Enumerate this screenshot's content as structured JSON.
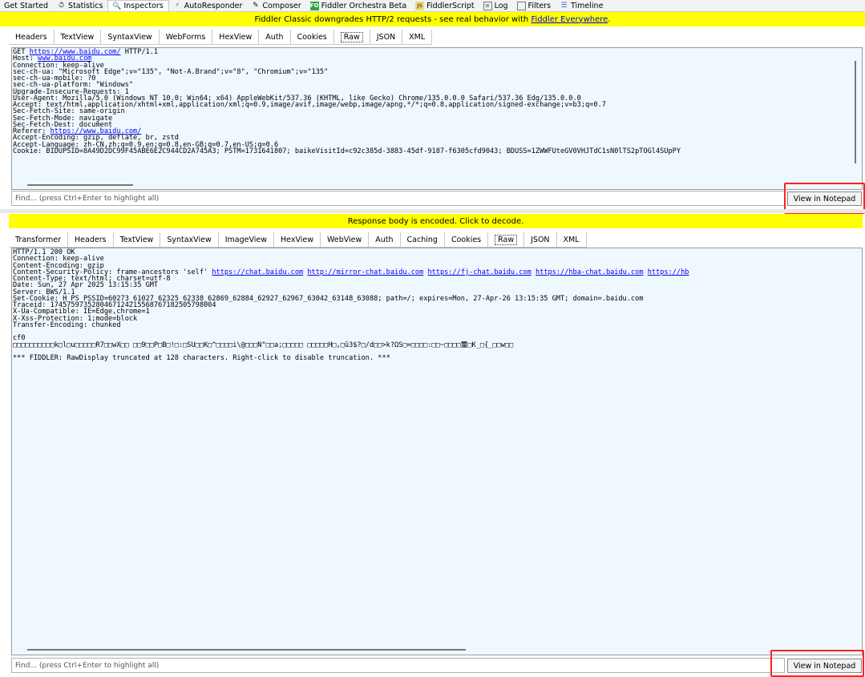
{
  "top_tabs": [
    {
      "label": "Get Started",
      "icon": "none"
    },
    {
      "label": "Statistics",
      "icon": "stopwatch-icon"
    },
    {
      "label": "Inspectors",
      "icon": "inspectors-icon"
    },
    {
      "label": "AutoResponder",
      "icon": "lightning-icon"
    },
    {
      "label": "Composer",
      "icon": "composer-icon"
    },
    {
      "label": "Fiddler Orchestra Beta",
      "icon": "fo-icon",
      "badge": "FO"
    },
    {
      "label": "FiddlerScript",
      "icon": "js-icon",
      "badge": "JS"
    },
    {
      "label": "Log",
      "icon": "log-icon"
    },
    {
      "label": "Filters",
      "icon": "checkbox-icon"
    },
    {
      "label": "Timeline",
      "icon": "timeline-icon"
    }
  ],
  "request": {
    "banner_text": "Fiddler Classic downgrades HTTP/2 requests - see real behavior with ",
    "banner_link": "Fiddler Everywhere",
    "banner_suffix": ".",
    "tabs": [
      "Headers",
      "TextView",
      "SyntaxView",
      "WebForms",
      "HexView",
      "Auth",
      "Cookies",
      "Raw",
      "JSON",
      "XML"
    ],
    "active_tab": "Raw",
    "lines": [
      [
        [
          "GET ",
          ""
        ],
        [
          "https://www.baidu.com/",
          "link"
        ],
        [
          " HTTP/1.1",
          ""
        ]
      ],
      [
        [
          "Host: ",
          ""
        ],
        [
          "www.baidu.com",
          "link"
        ]
      ],
      [
        [
          "Connection: keep-alive",
          ""
        ]
      ],
      [
        [
          "sec-ch-ua: \"Microsoft Edge\";v=\"135\", \"Not-A.Brand\";v=\"8\", \"Chromium\";v=\"135\"",
          ""
        ]
      ],
      [
        [
          "sec-ch-ua-mobile: ?0",
          ""
        ]
      ],
      [
        [
          "sec-ch-ua-platform: \"Windows\"",
          ""
        ]
      ],
      [
        [
          "Upgrade-Insecure-Requests: 1",
          ""
        ]
      ],
      [
        [
          "User-Agent: Mozilla/5.0 (Windows NT 10.0; Win64; x64) AppleWebKit/537.36 (KHTML, like Gecko) Chrome/135.0.0.0 Safari/537.36 Edg/135.0.0.0",
          ""
        ]
      ],
      [
        [
          "Accept: text/html,application/xhtml+xml,application/xml;q=0.9,image/avif,image/webp,image/apng,*/*;q=0.8,application/signed-exchange;v=b3;q=0.7",
          ""
        ]
      ],
      [
        [
          "Sec-Fetch-Site: same-origin",
          ""
        ]
      ],
      [
        [
          "Sec-Fetch-Mode: navigate",
          ""
        ]
      ],
      [
        [
          "Sec-Fetch-Dest: document",
          ""
        ]
      ],
      [
        [
          "Referer: ",
          ""
        ],
        [
          "https://www.baidu.com/",
          "link"
        ]
      ],
      [
        [
          "Accept-Encoding: gzip, deflate, br, zstd",
          ""
        ]
      ],
      [
        [
          "Accept-Language: zh-CN,zh;q=0.9,en;q=0.8,en-GB;q=0.7,en-US;q=0.6",
          ""
        ]
      ],
      [
        [
          "Cookie: BIDUPSID=8A49D2DC99F45ABE6E2C944CD2A745A3; PSTM=1731641807; baikeVisitId=c92c385d-3883-45df-9187-f6305cfd9043; BDUSS=1ZWWFUteGV0VHJTdC1sN0lTS2pTOGl4SUpPY",
          ""
        ]
      ]
    ],
    "find_placeholder": "Find... (press Ctrl+Enter to highlight all)",
    "notepad_label": "View in Notepad"
  },
  "response": {
    "banner_text": "Response body is encoded. Click to decode.",
    "tabs": [
      "Transformer",
      "Headers",
      "TextView",
      "SyntaxView",
      "ImageView",
      "HexView",
      "WebView",
      "Auth",
      "Caching",
      "Cookies",
      "Raw",
      "JSON",
      "XML"
    ],
    "active_tab": "Raw",
    "lines": [
      [
        [
          "HTTP/1.1 200 OK",
          ""
        ]
      ],
      [
        [
          "Connection: keep-alive",
          ""
        ]
      ],
      [
        [
          "Content-Encoding: gzip",
          ""
        ]
      ],
      [
        [
          "Content-Security-Policy: frame-ancestors 'self' ",
          ""
        ],
        [
          "https://chat.baidu.com",
          "link"
        ],
        [
          " ",
          ""
        ],
        [
          "http://mirror-chat.baidu.com",
          "link"
        ],
        [
          " ",
          ""
        ],
        [
          "https://fj-chat.baidu.com",
          "link"
        ],
        [
          " ",
          ""
        ],
        [
          "https://hba-chat.baidu.com",
          "link"
        ],
        [
          " ",
          ""
        ],
        [
          "https://hb",
          "link"
        ]
      ],
      [
        [
          "Content-Type: text/html; charset=utf-8",
          ""
        ]
      ],
      [
        [
          "Date: Sun, 27 Apr 2025 13:15:35 GMT",
          ""
        ]
      ],
      [
        [
          "Server: BWS/1.1",
          ""
        ]
      ],
      [
        [
          "Set-Cookie: H_PS_PSSID=60273_61027_62325_62338_62869_62884_62927_62967_63042_63148_63088; path=/; expires=Mon, 27-Apr-26 13:15:35 GMT; domain=.baidu.com",
          ""
        ]
      ],
      [
        [
          "Traceid: 1745759735280467124215568767182505798004",
          ""
        ]
      ],
      [
        [
          "X-Ua-Compatible: IE=Edge,chrome=1",
          ""
        ]
      ],
      [
        [
          "X-Xss-Protection: 1;mode=block",
          ""
        ]
      ],
      [
        [
          "Transfer-Encoding: chunked",
          ""
        ]
      ],
      [
        [
          "",
          ""
        ]
      ],
      [
        [
          "cf0",
          ""
        ]
      ],
      [
        [
          "□□□□□□□□□□k□l□u□□□□□R7□□wX□□ □□9□□P□B□!□:□SU□□K□^□□□□i\\@□□□N\"□□a;□□□□□ □□□□□H□,□û3$?□/d□□>k?ΩS□=□□□□:□□~□□□□璽□K_□{_□□w□□",
          ""
        ]
      ],
      [
        [
          "",
          ""
        ]
      ],
      [
        [
          "*** FIDDLER: RawDisplay truncated at 128 characters. Right-click to disable truncation. ***",
          ""
        ]
      ]
    ],
    "find_placeholder": "Find... (press Ctrl+Enter to highlight all)",
    "notepad_label": "View in Notepad"
  },
  "colors": {
    "banner": "#ffff00",
    "textbox_bg": "#f0f8ff",
    "highlight": "#ff2020",
    "link": "#0000ee"
  }
}
